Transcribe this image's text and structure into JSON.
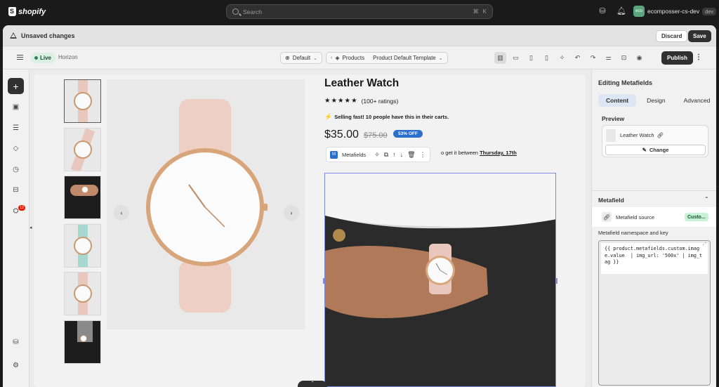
{
  "topbar": {
    "brand": "shopify",
    "search_placeholder": "Search",
    "shortcut_key1": "⌘",
    "shortcut_key2": "K",
    "account_initials": "eco",
    "account_name": "ecomposser-cs-dev",
    "account_env": "dev"
  },
  "unsaved": {
    "message": "Unsaved changes",
    "discard_label": "Discard",
    "save_label": "Save"
  },
  "editor_toolbar": {
    "status": "Live",
    "theme_name": "Horizon",
    "template_selector": "Default",
    "breadcrumb_1": "Products",
    "breadcrumb_2": "Product Default Template",
    "publish_label": "Publish"
  },
  "sidebar": {
    "notification_count": "12"
  },
  "product": {
    "title": "Leather Watch",
    "rating_text": "(100+ ratings)",
    "urgency": "Selling fast! 10 people have this in their carts.",
    "price": "$35.00",
    "compare_price": "$75.00",
    "discount": "53% OFF",
    "shipping_prefix": "o get it between",
    "shipping_date": "Thursday, 17th",
    "block_toolbar_label": "Metafields"
  },
  "panel": {
    "title": "Editing Metafields",
    "tabs": [
      "Content",
      "Design",
      "Advanced"
    ],
    "preview_label": "Preview",
    "preview_product": "Leather Watch",
    "change_label": "Change",
    "metafield_label": "Metafield",
    "source_label": "Metafield source",
    "source_value": "Custo...",
    "namespace_label": "Metafield namespace and key",
    "code": "{{ product.metafields.custom.image.value  | img_url: '500x' | img_tag }}"
  },
  "colors": {
    "topbar_bg": "#1a1a1a",
    "live_green": "#29845a",
    "discount_blue": "#2c6ecb",
    "badge_red": "#e51c00",
    "custom_green": "#c8f2d5"
  }
}
